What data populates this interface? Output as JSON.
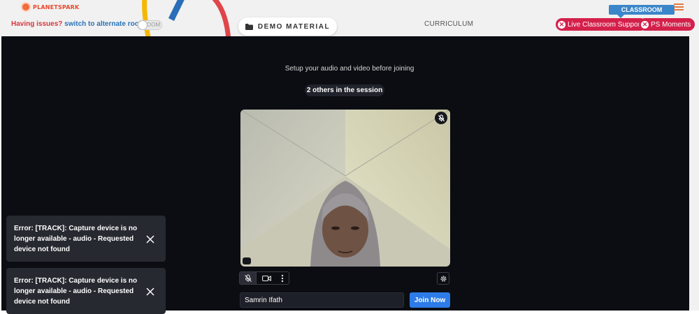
{
  "header": {
    "logo_text": "PLANETSPARK",
    "issues_warning": "Having issues?",
    "issues_link": "switch to alternate room",
    "zoom_toggle_label": "OOM",
    "demo_material_label": "DEMO MATERIAL",
    "curriculum_label": "CURRICULUM",
    "classroom_tab_label": "CLASSROOM",
    "live_support_label": "Live Classroom Support",
    "ps_moments_label": "PS Moments"
  },
  "prejoin": {
    "setup_text": "Setup your audio and video before joining",
    "others_badge": "2 others in the session",
    "name_value": "Samrin Ifath",
    "join_label": "Join Now"
  },
  "toasts": [
    {
      "message": "Error: [TRACK]: Capture device is no longer available - audio - Requested device not found"
    },
    {
      "message": "Error: [TRACK]: Capture device is no longer available - audio - Requested device not found"
    }
  ],
  "icons": [
    "folder-icon",
    "menu-icon",
    "close-circle-icon",
    "mic-off-icon",
    "camera-icon",
    "more-vertical-icon",
    "settings-icon",
    "network-icon",
    "close-icon"
  ],
  "colors": {
    "accent_blue": "#2d7be8",
    "brand_red": "#d4204b",
    "classroom_blue": "#3b86c9",
    "stage_bg": "#0b0d12"
  }
}
